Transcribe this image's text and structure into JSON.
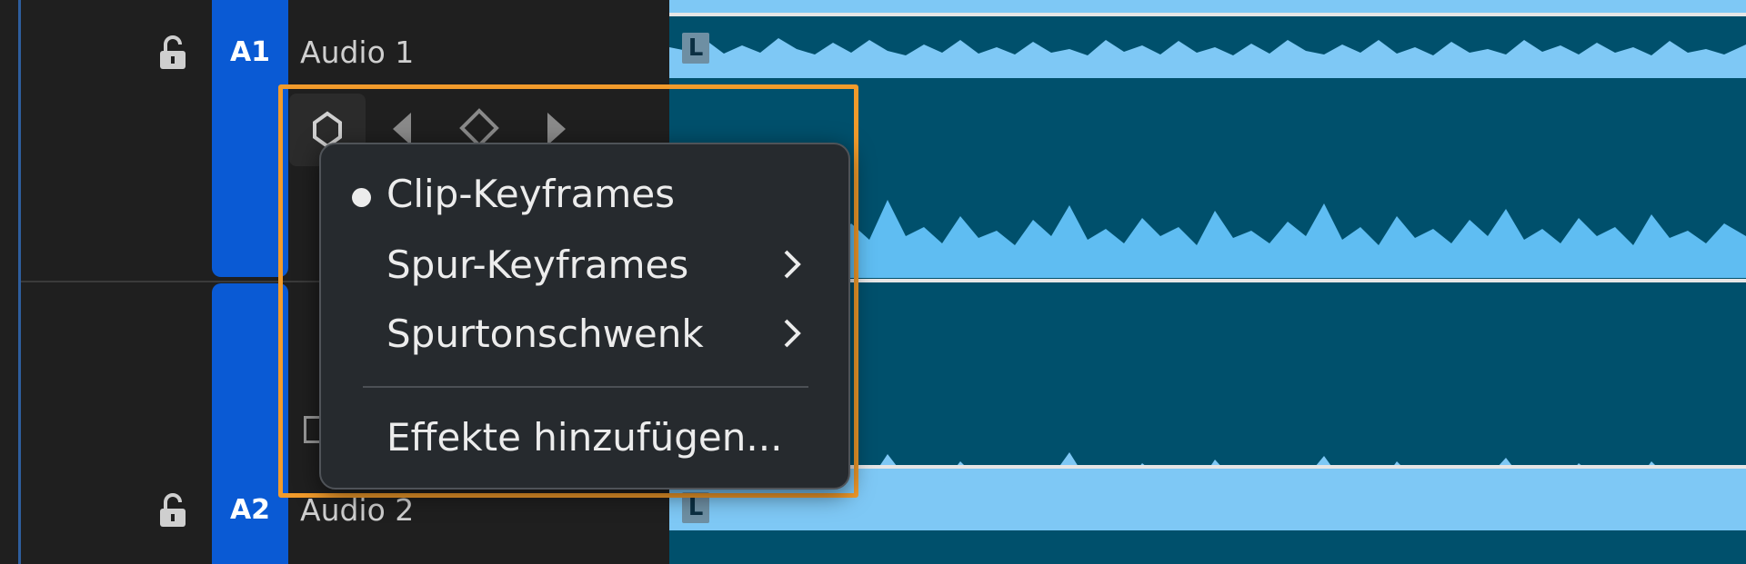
{
  "tracks": [
    {
      "id": "A1",
      "name": "Audio 1",
      "channel_badge": "L"
    },
    {
      "id": "A2",
      "name": "Audio 2",
      "channel_badge": "L"
    }
  ],
  "keyframe_controls": {
    "icons": [
      "keyframe-toggle-icon",
      "previous-keyframe-icon",
      "add-keyframe-icon",
      "next-keyframe-icon"
    ]
  },
  "context_menu": {
    "items": [
      {
        "label": "Clip-Keyframes",
        "checked": true,
        "has_submenu": false
      },
      {
        "label": "Spur-Keyframes",
        "checked": false,
        "has_submenu": true
      },
      {
        "label": "Spurtonschwenk",
        "checked": false,
        "has_submenu": true
      },
      {
        "label": "Effekte hinzufügen...",
        "checked": false,
        "has_submenu": false
      }
    ]
  },
  "colors": {
    "track_tab": "#0a5ad4",
    "clip_fill": "#7ec8f5",
    "timeline_bg": "#00506c",
    "highlight": "#f29b2b"
  }
}
